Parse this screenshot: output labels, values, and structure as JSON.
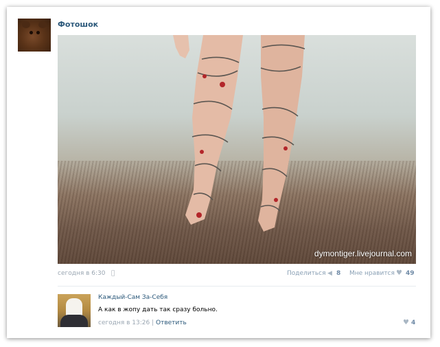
{
  "post": {
    "author": "Фотошок",
    "watermark": "dymontiger.livejournal.com",
    "time": "сегодня в 6:30",
    "share_label": "Поделиться",
    "share_count": "8",
    "like_label": "Мне нравится",
    "like_count": "49"
  },
  "comment": {
    "author": "Каждый-Сам За-Себя",
    "text": "А как в жопу дать так сразу больно.",
    "time": "сегодня в 13:26",
    "separator": "|",
    "reply_label": "Ответить",
    "like_count": "4"
  },
  "icons": {
    "apple": "apple-icon",
    "share": "megaphone-icon",
    "like": "heart-icon"
  },
  "colors": {
    "link": "#2b587a",
    "meta": "#9aa6b2",
    "count": "#6f8aa6"
  }
}
